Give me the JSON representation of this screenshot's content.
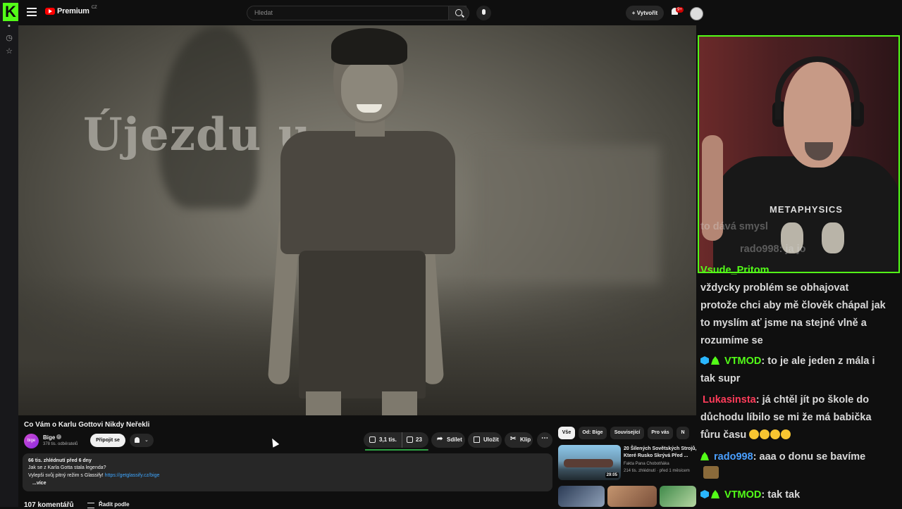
{
  "outer_app": {
    "logo_letter": "K"
  },
  "header": {
    "logo": "Premium",
    "logo_region": "CZ",
    "search_placeholder": "Hledat",
    "create_label": "Vytvořit",
    "notifications_badge": "9+"
  },
  "video": {
    "overlay_text": "Újezdu u",
    "title": "Co Vám o Karlu Gottovi Nikdy Neřekli",
    "channel": {
      "name": "Bige",
      "subscribers": "378 tis. odběratelů",
      "avatar_text": "bige"
    },
    "subscribe_label": "Připojit se",
    "likes": "3,1 tis.",
    "dislikes": "23",
    "like_ratio": 0.99,
    "share_label": "Sdílet",
    "save_label": "Uložit",
    "clip_label": "Klip",
    "more_label": "⋯",
    "description": {
      "views_date": "66 tis. zhlédnutí  před 6 dny",
      "line2": "Jak se z Karla Gotta stala legenda?",
      "line3": "Vylepši svůj pitný režim s Glassify!",
      "link": "https://getglassify.cz/bige",
      "more": "...více"
    },
    "comments_count": "107 komentářů",
    "sort_label": "Řadit podle"
  },
  "recommendations": {
    "chips": [
      "Vše",
      "Od: Bige",
      "Související",
      "Pro vás",
      "N"
    ],
    "active_chip": 0,
    "items": [
      {
        "title": "20 Šílených Sovětských Strojů, Které Rusko Skrývá Před ...",
        "channel": "Fakta Pana Chobotňáka",
        "meta": "214 tis. zhlédnutí · před 1 měsícem",
        "duration": "29:05"
      }
    ]
  },
  "chat": {
    "messages": [
      {
        "user": "",
        "text": "to dává smysl",
        "faded": true
      },
      {
        "user": "rado998",
        "text": ": ja jo",
        "faded": true
      },
      {
        "user": "Vsude_Pritom",
        "text": ": ide mám právě vždycky problém se obhajovat protože chci aby mě člověk chápal jak to myslím ať jsme na stejné vlně a rozumíme se"
      },
      {
        "user": "VTMOD",
        "text": ": to je ale jeden z mála i tak supr"
      },
      {
        "user": "Lukasinsta",
        "text": ": já chtěl jít po škole do důchodu líbilo se mi že má babička fůru času"
      },
      {
        "user": "rado998",
        "text": ": aaa o donu se bavíme"
      },
      {
        "user": "VTMOD",
        "text": ": tak tak"
      }
    ],
    "line3_rest": "vždycky problém se obhajovat",
    "line4": "protože chci aby mě člověk chápal jak",
    "line5": "to myslím ať jsme na stejné vlně a",
    "line6": "rozumíme se",
    "vtmod_1b": "tak supr",
    "luk_1": ": já chtěl jít po škole do",
    "luk_2": "důchodu líbilo se mi že má babička",
    "luk_3": "fůru času",
    "vtmod_1a": ": to je ale jeden z mála i",
    "cam_shirt_text": "METAPHYSICS"
  },
  "colors": {
    "kick_green": "#53fc18",
    "yt_red": "#ff0000",
    "link_blue": "#3ea6ff"
  }
}
